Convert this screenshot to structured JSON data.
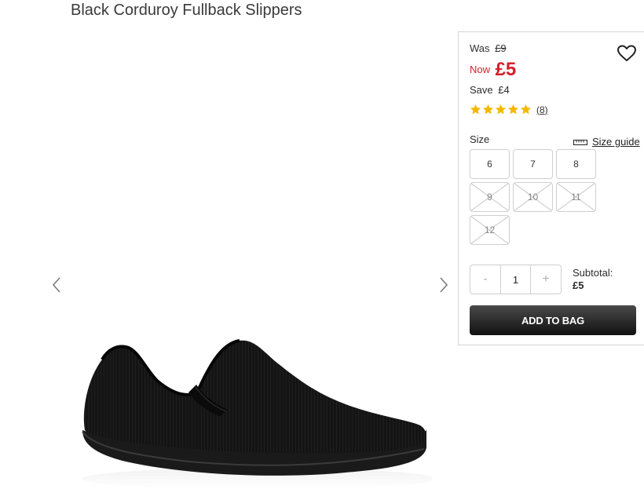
{
  "product": {
    "title": "Black Corduroy Fullback Slippers"
  },
  "pricing": {
    "was_label": "Was",
    "was_value": "£9",
    "now_label": "Now",
    "now_value": "£5",
    "save_label": "Save",
    "save_value": "£4"
  },
  "rating": {
    "stars": 5,
    "review_count": "(8)"
  },
  "size": {
    "label": "Size",
    "guide_label": "Size guide",
    "options": [
      {
        "label": "6",
        "available": true
      },
      {
        "label": "7",
        "available": true
      },
      {
        "label": "8",
        "available": true
      },
      {
        "label": "9",
        "available": false
      },
      {
        "label": "10",
        "available": false
      },
      {
        "label": "11",
        "available": false
      },
      {
        "label": "12",
        "available": false
      }
    ]
  },
  "quantity": {
    "minus": "-",
    "value": "1",
    "plus": "+"
  },
  "subtotal": {
    "label": "Subtotal:",
    "value": "£5"
  },
  "cta": {
    "add_to_bag": "ADD TO BAG"
  },
  "icons": {
    "prev": "chevron-left-icon",
    "next": "chevron-right-icon",
    "wishlist": "heart-icon",
    "size_guide": "ruler-icon",
    "star": "star-icon"
  },
  "colors": {
    "price_red": "#d3202b",
    "star_gold": "#f5b800",
    "button_dark": "#1e1e1e"
  }
}
